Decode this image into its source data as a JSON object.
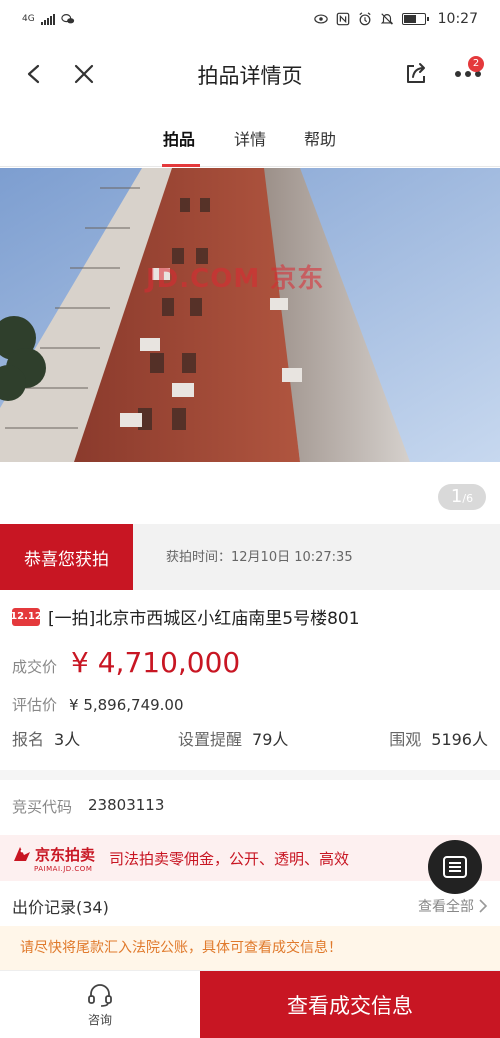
{
  "status_bar": {
    "network": "4G",
    "time": "10:27"
  },
  "nav": {
    "title": "拍品详情页",
    "badge_count": "2"
  },
  "tabs": [
    {
      "label": "拍品",
      "active": true
    },
    {
      "label": "详情",
      "active": false
    },
    {
      "label": "帮助",
      "active": false
    }
  ],
  "carousel": {
    "current": "1",
    "total": "/6",
    "watermark": "JD.COM 京东"
  },
  "won": {
    "tag": "恭喜您获拍",
    "time": "获拍时间：12月10日 10:27:35"
  },
  "lot": {
    "tag": "12.12",
    "title": "[一拍]北京市西城区小红庙南里5号楼801",
    "deal_label": "成交价",
    "deal_price": "¥ 4,710,000",
    "estimate_label": "评估价",
    "estimate_price": "¥ 5,896,749.00",
    "stats": [
      {
        "label": "报名",
        "value": "3人"
      },
      {
        "label": "设置提醒",
        "value": "79人"
      },
      {
        "label": "围观",
        "value": "5196人"
      }
    ]
  },
  "code": {
    "label": "竞买代码",
    "value": "23803113"
  },
  "promo": {
    "brand_cn": "京东拍卖",
    "brand_en": "PAIMAI.JD.COM",
    "text": "司法拍卖零佣金，公开、透明、高效"
  },
  "bids": {
    "title": "出价记录(34)",
    "view_all": "查看全部"
  },
  "notice": "请尽快将尾款汇入法院公账，具体可查看成交信息！",
  "bottom": {
    "consult": "咨询",
    "cta": "查看成交信息"
  },
  "colors": {
    "brand_red": "#c81623",
    "notice_text": "#e07a2c"
  }
}
